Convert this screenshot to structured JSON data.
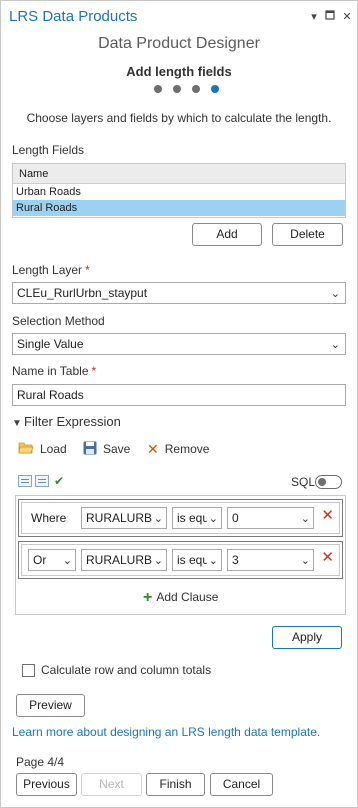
{
  "window": {
    "title": "LRS Data Products",
    "menu_icon": "chevron-down-icon",
    "pin_icon": "maximize-icon",
    "close_icon": "close-icon"
  },
  "designer": {
    "subtitle": "Data Product Designer",
    "step_title": "Add length fields",
    "steps_total": 4,
    "steps_active": 4,
    "instructions": "Choose layers and fields by which to calculate the length."
  },
  "length_fields": {
    "label": "Length Fields",
    "column_header": "Name",
    "rows": [
      "Urban Roads",
      "Rural Roads"
    ],
    "selected_index": 1,
    "add_label": "Add",
    "delete_label": "Delete"
  },
  "length_layer": {
    "label": "Length Layer",
    "required_mark": "*",
    "value": "CLEu_RurlUrbn_stayput"
  },
  "selection_method": {
    "label": "Selection Method",
    "value": "Single Value"
  },
  "name_in_table": {
    "label": "Name in Table",
    "required_mark": "*",
    "value": "Rural Roads"
  },
  "filter": {
    "section_label": "Filter Expression",
    "load_label": "Load",
    "save_label": "Save",
    "remove_label": "Remove",
    "sql_label": "SQL",
    "sql_on": false,
    "clauses": [
      {
        "connector": "Where",
        "field": "RURALURBA",
        "operator": "is equ",
        "value": "0"
      },
      {
        "connector": "Or",
        "field": "RURALURBA",
        "operator": "is equ",
        "value": "3"
      }
    ],
    "add_clause_label": "Add Clause",
    "apply_label": "Apply"
  },
  "totals": {
    "label": "Calculate row and column totals",
    "checked": false
  },
  "preview_label": "Preview",
  "help_link": "Learn more about designing an LRS length data template.",
  "footer": {
    "page_label": "Page 4/4",
    "previous_label": "Previous",
    "next_label": "Next",
    "finish_label": "Finish",
    "cancel_label": "Cancel"
  },
  "colors": {
    "accent": "#1e74b8",
    "selection": "#9dd1f0",
    "required": "#d61f1f",
    "remove": "#c0392b",
    "add": "#2e8b2e"
  }
}
